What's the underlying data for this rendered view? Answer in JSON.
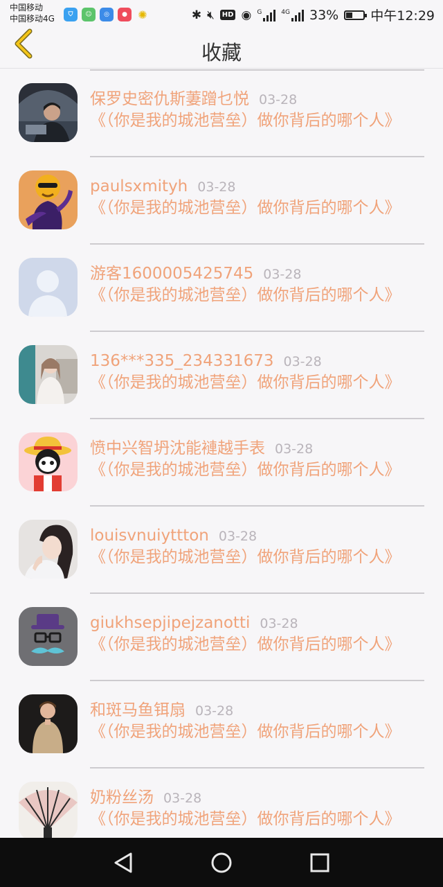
{
  "status_bar": {
    "carrier_1": "中国移动",
    "carrier_2": "中国移动4G",
    "network_1": "G",
    "network_2": "4G",
    "battery": "33%",
    "time": "中午12:29",
    "hd": "HD"
  },
  "header": {
    "title": "收藏",
    "back_icon": "chevron-left-icon"
  },
  "favorites": [
    {
      "name": "保罗史密仇斯萋蹭乜悦",
      "date": "03-28",
      "text": "《（你是我的城池营垒）做你背后的哪个人》",
      "avatar": "man-with-umbrella"
    },
    {
      "name": "paulsxmityh",
      "date": "03-28",
      "text": "《（你是我的城池营垒）做你背后的哪个人》",
      "avatar": "cartoon-figure-sunglasses"
    },
    {
      "name": "游客1600005425745",
      "date": "03-28",
      "text": "《（你是我的城池营垒）做你背后的哪个人》",
      "avatar": "default-silhouette"
    },
    {
      "name": "136***335_234331673",
      "date": "03-28",
      "text": "《（你是我的城池营垒）做你背后的哪个人》",
      "avatar": "girl-photo"
    },
    {
      "name": "愤中兴智坍沈能褳越手表",
      "date": "03-28",
      "text": "《（你是我的城池营垒）做你背后的哪个人》",
      "avatar": "cartoon-straw-hat"
    },
    {
      "name": "louisvnuiyttton",
      "date": "03-28",
      "text": "《（你是我的城池营垒）做你背后的哪个人》",
      "avatar": "woman-portrait"
    },
    {
      "name": "giukhsepjipejzanotti",
      "date": "03-28",
      "text": "《（你是我的城池营垒）做你背后的哪个人》",
      "avatar": "hat-glasses-mustache"
    },
    {
      "name": "和斑马鱼铒扇",
      "date": "03-28",
      "text": "《（你是我的城池营垒）做你背后的哪个人》",
      "avatar": "man-standing"
    },
    {
      "name": "奶粉丝汤",
      "date": "03-28",
      "text": "《（你是我的城池营垒）做你背后的哪个人》",
      "avatar": "folding-fan"
    }
  ],
  "colors": {
    "accent": "#f0a37a",
    "date": "#b9b4ba",
    "background": "#f7f6f8",
    "back_icon": "#f4c518"
  },
  "system_nav": [
    "back-triangle-icon",
    "home-circle-icon",
    "recents-square-icon"
  ]
}
